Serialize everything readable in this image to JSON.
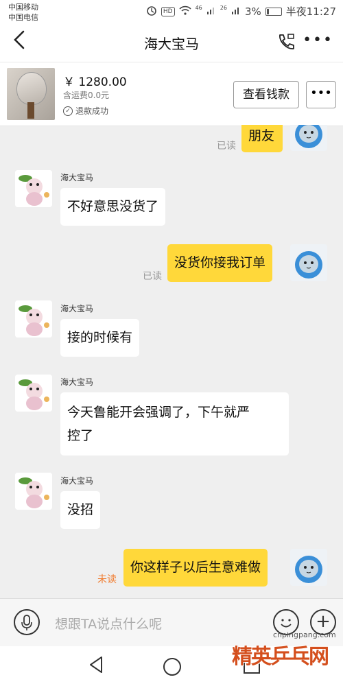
{
  "status": {
    "carrier1": "中国移动",
    "carrier2": "中国电信",
    "hd": "HD",
    "net1": "46",
    "net2": "26",
    "battery": "3%",
    "time": "半夜11:27"
  },
  "header": {
    "title": "海大宝马"
  },
  "product": {
    "price": "￥ 1280.00",
    "shipping": "含运费0.0元",
    "status": "退款成功",
    "view_button": "查看钱款",
    "more_button": "•••"
  },
  "chat": {
    "top_partial": {
      "text": "朋友",
      "status": "已读"
    },
    "messages": [
      {
        "sender": "海大宝马",
        "text": "不好意思没货了"
      },
      {
        "text": "没货你接我订单",
        "status": "已读"
      },
      {
        "sender": "海大宝马",
        "text": "接的时候有"
      },
      {
        "sender": "海大宝马",
        "text_line1": "今天鲁能开会强调了，下午就严",
        "text_line2": "控了"
      },
      {
        "sender": "海大宝马",
        "text": "没招"
      },
      {
        "text": "你这样子以后生意难做",
        "status": "未读"
      }
    ]
  },
  "input": {
    "placeholder": "想跟TA说点什么呢"
  },
  "watermark": {
    "url": "cnpingpang.com",
    "logo": "精英乒乓网"
  },
  "colors": {
    "self_bubble": "#ffd83a",
    "unread": "#f07b2e"
  }
}
